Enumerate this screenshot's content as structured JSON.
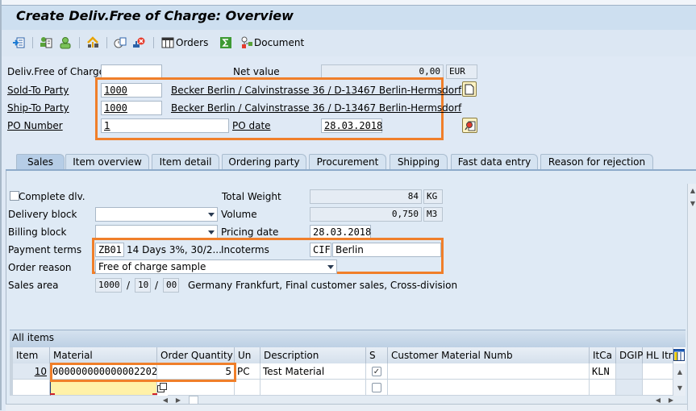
{
  "window": {
    "title": "Create Deliv.Free of Charge: Overview"
  },
  "toolbar": {
    "icons": [
      "display-doc-header-icon",
      "header-details-icon",
      "sold-to-party-icon",
      "hierarchy-icon",
      "copy-doc-icon",
      "cancel-doc-icon",
      "orders-grid-icon",
      "sum-icon",
      "document-flow-icon"
    ],
    "orders_label": "Orders",
    "document_label": "Document"
  },
  "header": {
    "deliv_free_label": "Deliv.Free of Charge",
    "deliv_free_value": "",
    "net_value_label": "Net value",
    "net_value": "0,00",
    "currency": "EUR",
    "sold_to_label": "Sold-To Party",
    "sold_to_value": "1000",
    "sold_to_desc": "Becker Berlin / Calvinstrasse 36 / D-13467 Berlin-Hermsdorf",
    "ship_to_label": "Ship-To Party",
    "ship_to_value": "1000",
    "ship_to_desc": "Becker Berlin / Calvinstrasse 36 / D-13467 Berlin-Hermsdorf",
    "po_number_label": "PO Number",
    "po_number_value": "1",
    "po_date_label": "PO date",
    "po_date_value": "28.03.2018"
  },
  "tabs": [
    {
      "label": "Sales",
      "active": true
    },
    {
      "label": "Item overview"
    },
    {
      "label": "Item detail"
    },
    {
      "label": "Ordering party"
    },
    {
      "label": "Procurement"
    },
    {
      "label": "Shipping"
    },
    {
      "label": "Fast data entry"
    },
    {
      "label": "Reason for rejection"
    }
  ],
  "sales": {
    "complete_dlv_label": "Complete dlv.",
    "complete_dlv_checked": false,
    "total_weight_label": "Total Weight",
    "total_weight_value": "84",
    "weight_unit": "KG",
    "delivery_block_label": "Delivery block",
    "delivery_block_value": "",
    "volume_label": "Volume",
    "volume_value": "0,750",
    "volume_unit": "M3",
    "billing_block_label": "Billing block",
    "billing_block_value": "",
    "pricing_date_label": "Pricing date",
    "pricing_date_value": "28.03.2018",
    "payment_terms_label": "Payment terms",
    "payment_terms_code": "ZB01",
    "payment_terms_desc": "14 Days 3%, 30/2...",
    "incoterms_label": "Incoterms",
    "incoterms_code": "CIF",
    "incoterms_place": "Berlin",
    "order_reason_label": "Order reason",
    "order_reason_value": "Free of charge sample",
    "sales_area_label": "Sales area",
    "sales_org": "1000",
    "distr_channel": "10",
    "division": "00",
    "sales_area_sep": "/",
    "sales_area_desc": "Germany Frankfurt, Final customer sales, Cross-division"
  },
  "items": {
    "title": "All items",
    "columns": [
      "Item",
      "Material",
      "Order Quantity",
      "Un",
      "Description",
      "S",
      "Customer Material Numb",
      "ItCa",
      "DGIP",
      "HL Itm"
    ],
    "rows": [
      {
        "item": "10",
        "material": "000000000000002202",
        "qty": "5",
        "unit": "PC",
        "description": "Test Material",
        "s_checked": true,
        "cust_mat": "",
        "itca": "KLN",
        "dgip": "",
        "hl": ""
      },
      {
        "item": "",
        "material": "",
        "qty": "",
        "unit": "",
        "description": "",
        "s_checked": false,
        "cust_mat": "",
        "itca": "",
        "dgip": "",
        "hl": ""
      }
    ]
  },
  "colors": {
    "highlight": "#f07f2a",
    "focus_field": "#fff1a8"
  }
}
